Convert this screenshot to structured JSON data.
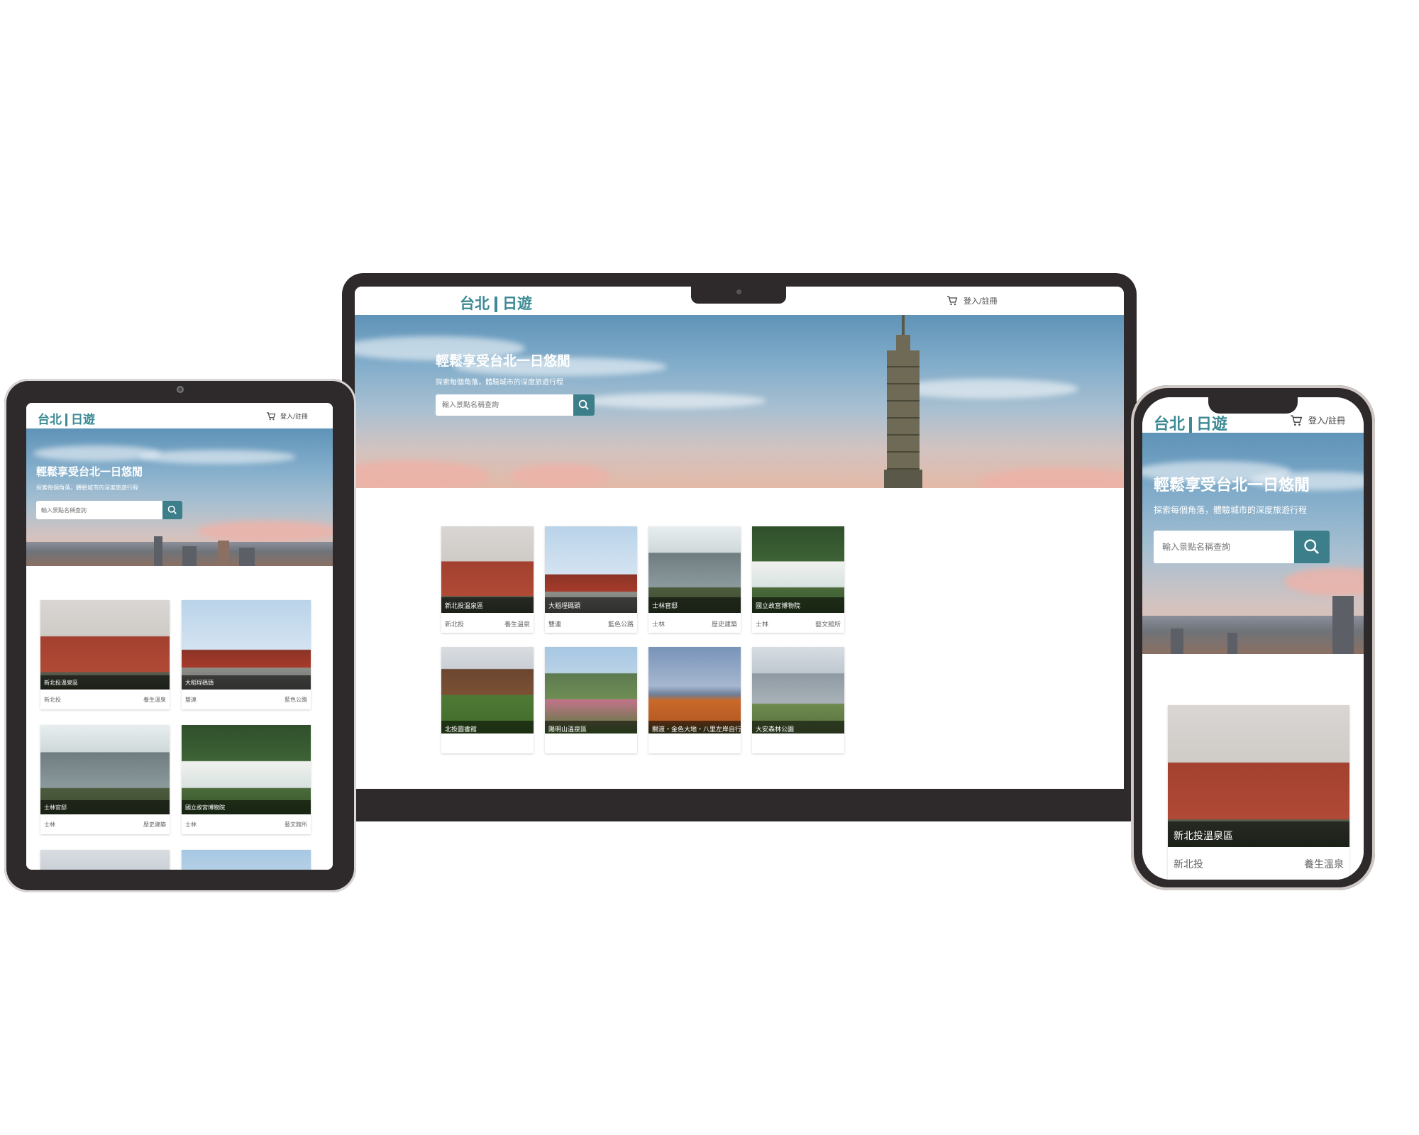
{
  "site": {
    "logo_left": "台北",
    "logo_right": "日遊",
    "login_label": "登入/註冊",
    "hero_title": "輕鬆享受台北一日悠閒",
    "hero_subtitle": "探索每個角落，體驗城市的深度旅遊行程",
    "search_placeholder": "輸入景點名稱查詢",
    "icons": [
      "cart-icon",
      "search-icon"
    ],
    "accent_color": "#3c8a94",
    "search_button_color": "#3c7f8a"
  },
  "cards": [
    {
      "name": "新北投溫泉區",
      "area": "新北投",
      "tag": "養生溫泉",
      "scene": "brick"
    },
    {
      "name": "大稻埕碼頭",
      "area": "雙連",
      "tag": "藍色公路",
      "scene": "junk"
    },
    {
      "name": "士林官邸",
      "area": "士林",
      "tag": "歷史建築",
      "scene": "house"
    },
    {
      "name": "國立故宮博物院",
      "area": "士林",
      "tag": "藝文館所",
      "scene": "palace"
    },
    {
      "name": "北投圖書館",
      "scene": "library"
    },
    {
      "name": "陽明山溫泉區",
      "scene": "hills"
    },
    {
      "name": "關渡・金色大地・八里左岸自行車道",
      "scene": "field"
    },
    {
      "name": "大安森林公園",
      "scene": "walk"
    }
  ]
}
